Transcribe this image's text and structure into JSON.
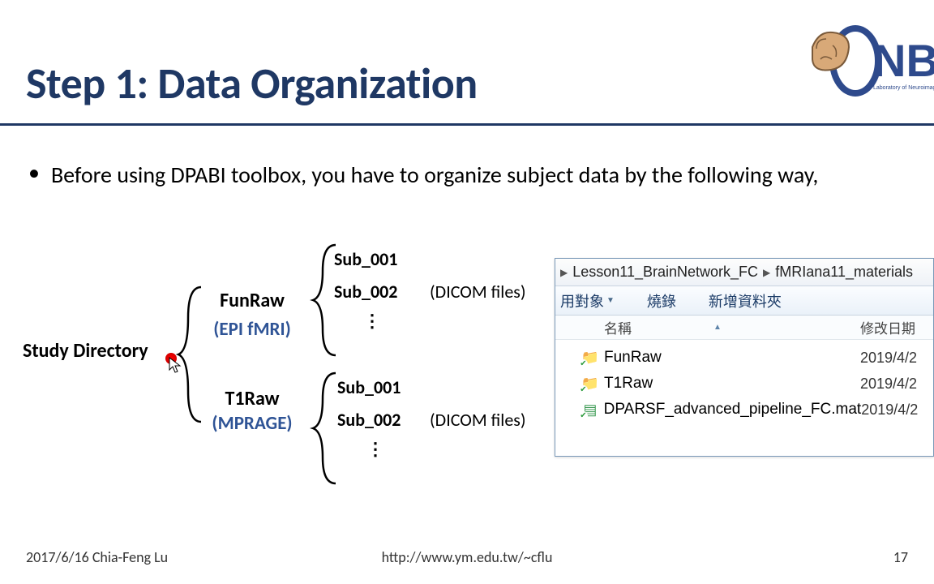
{
  "title": "Step 1: Data Organization",
  "logo_text": "NB",
  "logo_sub": "Laboratory of Neuroimage",
  "bullet_text": "Before using DPABI toolbox, you have to organize subject data by the following way,",
  "diagram": {
    "root": "Study Directory",
    "funraw": "FunRaw",
    "funraw_note": "(EPI fMRI)",
    "t1raw": "T1Raw",
    "t1raw_note": "(MPRAGE)",
    "sub1": "Sub_001",
    "sub2": "Sub_002",
    "dots": "⋮",
    "dicom": "(DICOM files)"
  },
  "explorer": {
    "crumb1": "Lesson11_BrainNetwork_FC",
    "crumb2": "fMRIana11_materials",
    "tool_target": "用對象",
    "tool_burn": "燒錄",
    "tool_new": "新增資料夾",
    "col_name": "名稱",
    "col_date": "修改日期",
    "rows": [
      {
        "name": "FunRaw",
        "type": "folder",
        "date": "2019/4/2"
      },
      {
        "name": "T1Raw",
        "type": "folder",
        "date": "2019/4/2"
      },
      {
        "name": "DPARSF_advanced_pipeline_FC.mat",
        "type": "mat",
        "date": "2019/4/2"
      }
    ]
  },
  "footer": {
    "left": "2017/6/16 Chia-Feng Lu",
    "center": "http://www.ym.edu.tw/~cflu",
    "right": "17"
  }
}
